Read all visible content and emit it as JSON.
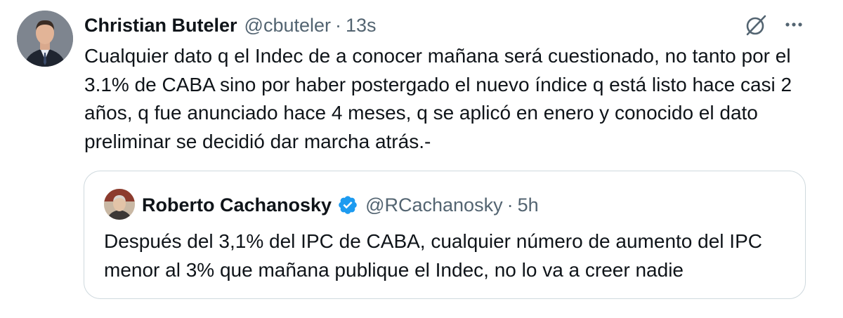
{
  "tweet": {
    "author_name": "Christian Buteler",
    "handle": "@cbuteler",
    "separator": "·",
    "time": "13s",
    "text": "Cualquier dato q el Indec de a conocer mañana será cuestionado, no tanto por el 3.1% de CABA sino por haber postergado el nuevo índice q está listo hace casi 2 años, q fue anunciado hace 4 meses, q se aplicó en enero y conocido el dato preliminar se decidió dar marcha atrás.-"
  },
  "quoted": {
    "author_name": "Roberto Cachanosky",
    "verified": true,
    "handle": "@RCachanosky",
    "separator": "·",
    "time": "5h",
    "text": "Después del 3,1% del IPC de CABA, cualquier número de aumento del IPC menor al 3% que mañana publique el Indec, no lo va a creer nadie"
  },
  "icons": {
    "avatar": "avatar",
    "grok": "grok-icon",
    "more": "more-icon",
    "verified": "verified-badge-icon"
  },
  "colors": {
    "text": "#0f1419",
    "secondary": "#536471",
    "verified": "#1d9bf0",
    "border": "#cfd9de"
  }
}
